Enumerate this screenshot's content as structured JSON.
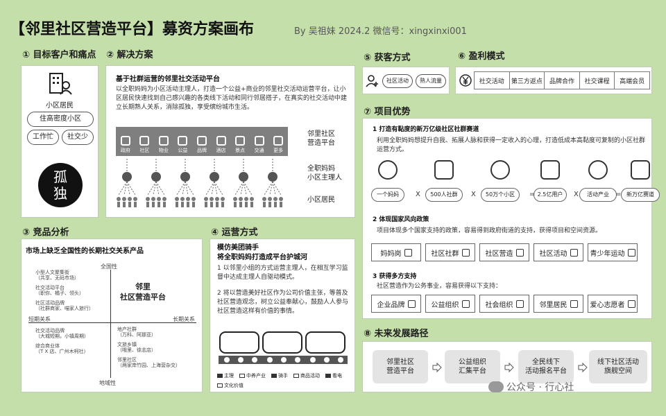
{
  "header": {
    "title": "【邻里社区营造平台】募资方案画布",
    "byline": "By 吴祖妹  2024.2  微信号：xingxinxi001"
  },
  "sec1": {
    "title": "① 目标客户和痛点",
    "icon_label": "小区居民",
    "pills": [
      "住高密度小区",
      "工作忙",
      "社交少"
    ],
    "circle_text": [
      "孤",
      "独"
    ]
  },
  "sec2": {
    "title": "② 解决方案",
    "subtitle": "基于社群运营的邻里社交活动平台",
    "desc": "以全职妈妈为小区活动主理人，打造一个公益+商业的邻里社交活动运营平台，让小区居民快速找到自己感兴趣的各类线下活动和同行邻居搭子，在真实的社交活动中建立长期熟人关系，消除孤独，享受缤纷城市生活。",
    "bar_items": [
      "政府",
      "社区",
      "物业",
      "公益",
      "品牌",
      "酒店",
      "景点",
      "交通",
      "更多"
    ],
    "side_labels": [
      "邻里社区\n营造平台",
      "全职妈妈\n小区主理人",
      "小区居民"
    ]
  },
  "sec3": {
    "title": "③ 竞品分析",
    "subtitle": "市场上缺乏全国性的长期社交关系产品",
    "axis_top": "全国性",
    "axis_bottom": "地域性",
    "axis_left": "短期关系",
    "axis_right": "长期关系",
    "center": "邻里\n社区营造平台",
    "tl": [
      "小型人文聚集街\n（共享、无码市场）",
      "社交活动平台\n（职你、橘子、领头）",
      "社区活动品牌\n（社群商家、喵家人旅行）"
    ],
    "bl": [
      "社交活动品牌\n（大城短期，小镇周期）",
      "综合商业体\n（T X 店、广州木柯社）"
    ],
    "br": [
      "地产社群\n（万科、阿那亚）",
      "文旅乡镇\n（哦里、徐志店）",
      "邻里社区\n（两家岸竹园、上海营杂交）"
    ]
  },
  "sec4": {
    "title": "④ 运营方式",
    "subtitle": "模仿美团骑手\n将全职妈妈打造成平台护城河",
    "points": [
      "1  以邻里小组的方式运营主理人，在相互学习监督中达成主理人自驱动模式。",
      "2  将以营造美好社区作为公司价值主张，等普及社区营造观念，树立公益奉献心，鼓励人人参与社区营造这样有价值的事情。"
    ],
    "legend": [
      "主理",
      "中养产业",
      "骑手",
      "商品活动",
      "看电",
      "文化价值"
    ]
  },
  "sec5": {
    "title": "⑤ 获客方式",
    "pills": [
      "社区活动",
      "熟人流量"
    ]
  },
  "sec6": {
    "title": "⑥ 盈利模式",
    "items": [
      "社交活动",
      "第三方返点",
      "品牌合作",
      "社交课程",
      "高端会员"
    ]
  },
  "sec7": {
    "title": "⑦ 项目优势",
    "p1_title": "1  打造有黏度的新万亿级社区社群赛道",
    "p1_desc": "利用全职妈妈想提升自我、拓展人脉和获得一定收入的心理，打造低成本高黏度可复制的小区社群运营方式。",
    "formula": [
      "一个妈妈",
      "500人社群",
      "50万个小区",
      "2.5亿用户",
      "活动产业",
      "新万亿赛道"
    ],
    "ops": [
      "X",
      "X",
      "=",
      "X",
      "="
    ],
    "p2_title": "2  体现国家风向政策",
    "p2_desc": "项目体现多个国家支持的政策，容易得到政府街道的支持，获得项目和空间资源。",
    "policies": [
      "妈妈岗",
      "社区社群",
      "社区营造",
      "社区活动",
      "青少年运动"
    ],
    "p3_title": "3  获得多方支持",
    "p3_desc": "社区营造作为公务事业，容易获得以下支持：",
    "supports": [
      "企业品牌",
      "公益组织",
      "社会组织",
      "邻里居民",
      "爱心志愿者"
    ]
  },
  "sec8": {
    "title": "⑧ 未来发展路径",
    "steps": [
      "邻里社区\n营造平台",
      "公益组织\n汇集平台",
      "全民线下\n活动报名平台",
      "线下社区活动\n旗舰空间"
    ],
    "watermark": "公众号 · 行心社"
  }
}
